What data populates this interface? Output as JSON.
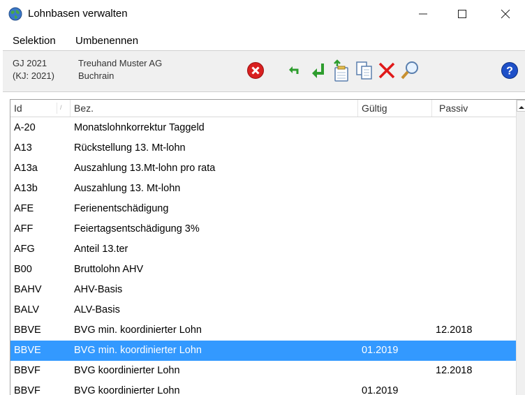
{
  "window": {
    "title": "Lohnbasen verwalten",
    "icons": {
      "app": "world-app-icon",
      "minimize": "minimize-icon",
      "maximize": "maximize-icon",
      "close": "close-icon"
    }
  },
  "menu": {
    "items": [
      "Selektion",
      "Umbenennen"
    ]
  },
  "toolbar": {
    "gj": "GJ 2021",
    "kj": "(KJ: 2021)",
    "company": "Treuhand Muster AG",
    "city": "Buchrain",
    "buttons": [
      "cancel-icon",
      "undo-icon",
      "enter-icon",
      "new-document-icon",
      "copy-icon",
      "delete-icon",
      "search-icon",
      "help-icon"
    ],
    "colors": {
      "cancel": "#d92020",
      "green": "#2e9d2e",
      "delete": "#e01818",
      "help": "#1e50c8"
    }
  },
  "table": {
    "columns": [
      "Id",
      "Bez.",
      "Gültig",
      "Passiv"
    ],
    "selected_color": "#3399ff",
    "rows": [
      {
        "id": "A-20",
        "bez": "Monatslohnkorrektur Taggeld",
        "gueltig": "",
        "passiv": ""
      },
      {
        "id": "A13",
        "bez": "Rückstellung 13. Mt-lohn",
        "gueltig": "",
        "passiv": ""
      },
      {
        "id": "A13a",
        "bez": "Auszahlung 13.Mt-lohn pro rata",
        "gueltig": "",
        "passiv": ""
      },
      {
        "id": "A13b",
        "bez": "Auszahlung 13. Mt-lohn",
        "gueltig": "",
        "passiv": ""
      },
      {
        "id": "AFE",
        "bez": "Ferienentschädigung",
        "gueltig": "",
        "passiv": ""
      },
      {
        "id": "AFF",
        "bez": "Feiertagsentschädigung 3%",
        "gueltig": "",
        "passiv": ""
      },
      {
        "id": "AFG",
        "bez": "Anteil 13.ter",
        "gueltig": "",
        "passiv": ""
      },
      {
        "id": "B00",
        "bez": "Bruttolohn AHV",
        "gueltig": "",
        "passiv": ""
      },
      {
        "id": "BAHV",
        "bez": "AHV-Basis",
        "gueltig": "",
        "passiv": ""
      },
      {
        "id": "BALV",
        "bez": "ALV-Basis",
        "gueltig": "",
        "passiv": ""
      },
      {
        "id": "BBVE",
        "bez": "BVG min. koordinierter Lohn",
        "gueltig": "",
        "passiv": "12.2018"
      },
      {
        "id": "BBVE",
        "bez": "BVG min. koordinierter Lohn",
        "gueltig": "01.2019",
        "passiv": "",
        "selected": true
      },
      {
        "id": "BBVF",
        "bez": "BVG koordinierter Lohn",
        "gueltig": "",
        "passiv": "12.2018"
      },
      {
        "id": "BBVF",
        "bez": "BVG koordinierter Lohn",
        "gueltig": "01.2019",
        "passiv": ""
      }
    ]
  }
}
